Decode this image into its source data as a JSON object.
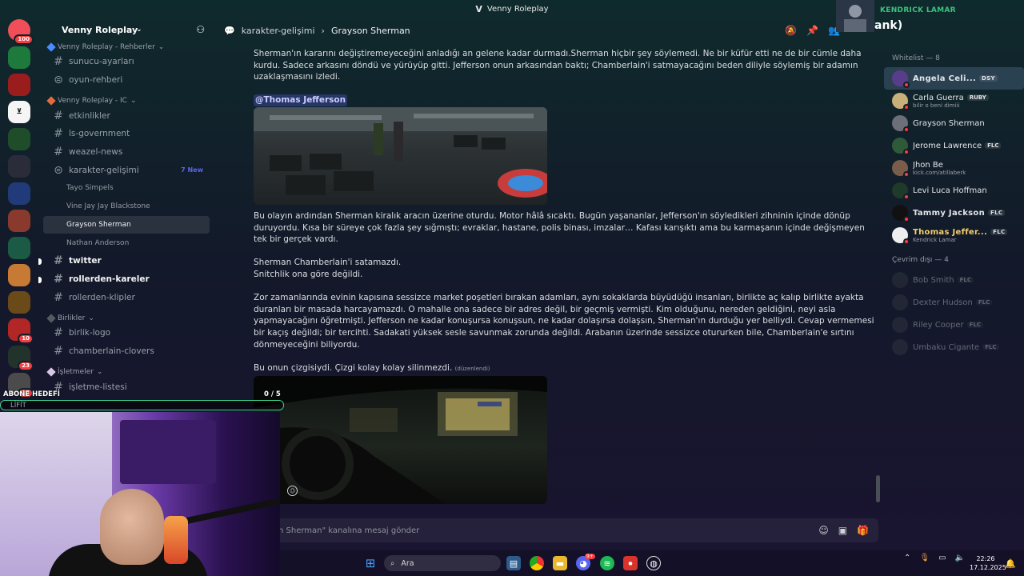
{
  "window": {
    "title": "Venny Roleplay",
    "logo": "V"
  },
  "servers": [
    {
      "name": "discord-home",
      "badge": "100",
      "color": "#f04f5a"
    },
    {
      "name": "server-clover-green",
      "badge": "",
      "color": "#1e7a3c"
    },
    {
      "name": "server-red",
      "badge": "",
      "color": "#9a1d1d"
    },
    {
      "name": "server-venny-v",
      "badge": "",
      "color": "#f5f5f5"
    },
    {
      "name": "server-shamrock",
      "badge": "",
      "color": "#1f4d2a"
    },
    {
      "name": "server-venny-logo",
      "badge": "",
      "color": "#2b2c3a"
    },
    {
      "name": "server-venny-blue",
      "badge": "",
      "color": "#213b7a"
    },
    {
      "name": "server-redhead",
      "badge": "",
      "color": "#8a3a2c"
    },
    {
      "name": "server-seal",
      "badge": "",
      "color": "#1b5a45"
    },
    {
      "name": "server-character",
      "badge": "",
      "color": "#c77a33"
    },
    {
      "name": "server-lion",
      "badge": "",
      "color": "#6b4a1a"
    },
    {
      "name": "server-santa",
      "badge": "10",
      "color": "#b32626"
    },
    {
      "name": "server-dark",
      "badge": "23",
      "color": "#22332c"
    },
    {
      "name": "server-grid",
      "badge": "15",
      "color": "#4b4b4b"
    }
  ],
  "sidebar": {
    "server_name": "Venny Roleplay",
    "categories": [
      {
        "label": "Venny Roleplay - Rehberler",
        "dot_color": "#4b8cff",
        "channels": [
          {
            "label": "sunucu-ayarları",
            "type": "text",
            "bold": false
          },
          {
            "label": "oyun-rehberi",
            "type": "forum",
            "bold": false
          }
        ]
      },
      {
        "label": "Venny Roleplay - IC",
        "dot_color": "#e66a3c",
        "channels": [
          {
            "label": "etkinlikler",
            "type": "text",
            "bold": false
          },
          {
            "label": "ls-government",
            "type": "text",
            "bold": false
          },
          {
            "label": "weazel-news",
            "type": "text",
            "bold": false
          },
          {
            "label": "karakter-gelişimi",
            "type": "forum",
            "bold": false,
            "new": "7 New"
          }
        ],
        "threads": [
          "Tayo Simpels",
          "Vine Jay Jay Blackstone",
          "Grayson Sherman",
          "Nathan Anderson"
        ],
        "active_thread": "Grayson Sherman",
        "channels_after": [
          {
            "label": "twitter",
            "type": "text",
            "bold": true
          },
          {
            "label": "rollerden-kareler",
            "type": "text",
            "bold": true
          },
          {
            "label": "rollerden-klipler",
            "type": "text",
            "bold": false
          }
        ]
      },
      {
        "label": "Birlikler",
        "dot_color": "#555a62",
        "channels": [
          {
            "label": "birlik-logo",
            "type": "text",
            "bold": false
          },
          {
            "label": "chamberlain-clovers",
            "type": "text",
            "bold": false
          }
        ]
      },
      {
        "label": "İşletmeler",
        "dot_color": "#d9c6e6",
        "channels": [
          {
            "label": "işletme-listesi",
            "type": "text",
            "bold": false
          }
        ]
      }
    ]
  },
  "header": {
    "channel": "karakter-gelişimi",
    "separator": "›",
    "thread": "Grayson Sherman"
  },
  "messages": {
    "p1": "Sherman'ın kararını değiştiremeyeceğini anladığı an gelene kadar durmadı.Sherman hiçbir şey söylemedi. Ne bir küfür etti ne de bir cümle daha kurdu. Sadece arkasını döndü ve yürüyüp gitti. Jefferson onun arkasından baktı; Chamberlain'i satmayacağını beden diliyle söylemiş bir adamın uzaklaşmasını izledi.",
    "mention": "@Thomas Jefferson",
    "p2": "Bu olayın ardından Sherman kiralık aracın üzerine oturdu. Motor hâlâ sıcaktı. Bugün yaşananlar, Jefferson'ın söyledikleri zihninin içinde dönüp duruyordu. Kısa bir süreye çok fazla şey sığmıştı; evraklar, hastane, polis binası, imzalar… Kafası karışıktı ama bu karmaşanın içinde değişmeyen tek bir gerçek vardı.",
    "p3a": "Sherman Chamberlain'i satamazdı.",
    "p3b": "Snitchlik ona göre değildi.",
    "p4": "Zor zamanlarında evinin kapısına sessizce market poşetleri bırakan adamları, aynı sokaklarda büyüdüğü insanları, birlikte aç kalıp birlikte ayakta duranları bir masada harcayamazdı. O mahalle ona sadece bir adres değil, bir geçmiş vermişti. Kim olduğunu, nereden geldiğini, neyi asla yapmayacağını öğretmişti. Jefferson ne kadar konuşursa konuşsun, ne kadar dolaşırsa dolaşsın, Sherman'ın durduğu yer belliydi. Cevap vermemesi bir kaçış değildi; bir tercihti. Sadakati yüksek sesle savunmak zorunda değildi. Arabanın üzerinde sessizce otururken bile, Chamberlain'e sırtını dönmeyeceğini biliyordu.",
    "p5": "Bu onun çizgisiydi. Çizgi kolay kolay silinmezdi.",
    "edited": "(düzenlendi)"
  },
  "composer": {
    "placeholder": "n Sherman\" kanalına mesaj gönder"
  },
  "members": {
    "online_header": "Whitelist — 8",
    "online": [
      {
        "name": "Angela Celi...",
        "tag": "DSY",
        "sub": "",
        "fancy": true,
        "highlight": true,
        "avatar": "#5a3d8a"
      },
      {
        "name": "Carla Guerra",
        "tag": "RUBY",
        "sub": "bilir o beni dimiii",
        "fancy": false,
        "highlight": false,
        "avatar": "#c9b07a"
      },
      {
        "name": "Grayson Sherman",
        "tag": "",
        "sub": "",
        "fancy": false,
        "highlight": false,
        "avatar": "#6b6f78"
      },
      {
        "name": "Jerome Lawrence",
        "tag": "FLC",
        "sub": "",
        "fancy": false,
        "highlight": false,
        "avatar": "#2f5a3a"
      },
      {
        "name": "Jhon Be",
        "tag": "",
        "sub": "kick.com/atillaberk",
        "fancy": false,
        "highlight": false,
        "avatar": "#7a5c4a"
      },
      {
        "name": "Levi Luca Hoffman",
        "tag": "",
        "sub": "",
        "fancy": false,
        "highlight": false,
        "avatar": "#1f3a2a"
      },
      {
        "name": "Tammy Jackson",
        "tag": "FLC",
        "sub": "",
        "fancy": true,
        "highlight": false,
        "avatar": "#111111"
      },
      {
        "name": "Thomas Jeffer...",
        "tag": "FLC",
        "sub": "Kendrick Lamar",
        "fancy": true,
        "highlight": false,
        "avatar": "#eeeeee",
        "gold": true
      }
    ],
    "offline_header": "Çevrim dışı — 4",
    "offline": [
      {
        "name": "Bob Smith",
        "tag": "FLC"
      },
      {
        "name": "Dexter Hudson",
        "tag": "FLC"
      },
      {
        "name": "Riley Cooper",
        "tag": "FLC"
      },
      {
        "name": "Umbaku Cigante",
        "tag": "FLC"
      }
    ]
  },
  "stream_overlay": {
    "now_playing_artist": "KENDRICK LAMAR",
    "now_playing_track": "ank)",
    "goal_label": "ABONE HEDEFİ",
    "goal_count": "0 / 5",
    "goal_progress": 0,
    "goal_name": "LİFİT"
  },
  "taskbar": {
    "search_placeholder": "Ara",
    "time": "22:26",
    "date": "17.12.2025",
    "discord_badge": "9+"
  }
}
